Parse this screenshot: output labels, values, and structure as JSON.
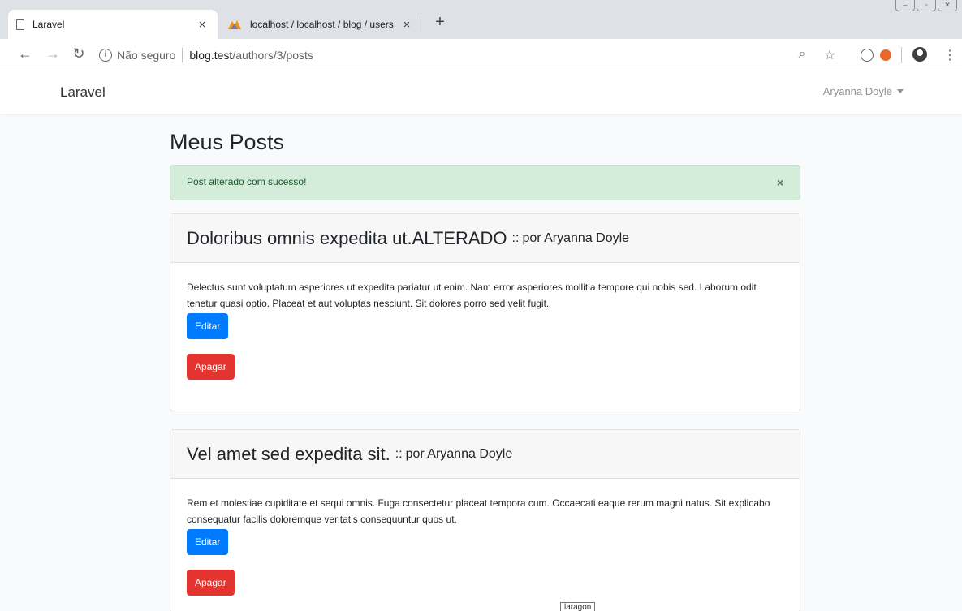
{
  "browser": {
    "tabs": [
      {
        "title": "Laravel",
        "close": "×"
      },
      {
        "title": "localhost / localhost / blog / users",
        "close": "×"
      }
    ],
    "new_tab": "+",
    "address": {
      "security": "Não seguro",
      "host": "blog.test",
      "path": "/authors/3/posts"
    }
  },
  "navbar": {
    "brand": "Laravel",
    "user": "Aryanna Doyle"
  },
  "page": {
    "title": "Meus Posts"
  },
  "alert": {
    "message": "Post alterado com sucesso!",
    "close": "×"
  },
  "posts": [
    {
      "title": "Doloribus omnis expedita ut.ALTERADO",
      "separator": "::",
      "author": "por Aryanna Doyle",
      "body": "Delectus sunt voluptatum asperiores ut expedita pariatur ut enim. Nam error asperiores mollitia tempore qui nobis sed. Laborum odit tenetur quasi optio. Placeat et aut voluptas nesciunt. Sit dolores porro sed velit fugit.",
      "edit_label": "Editar",
      "delete_label": "Apagar"
    },
    {
      "title": "Vel amet sed expedita sit.",
      "separator": "::",
      "author": "por Aryanna Doyle",
      "body": "Rem et molestiae cupiditate et sequi omnis. Fuga consectetur placeat tempora cum. Occaecati eaque rerum magni natus. Sit explicabo consequatur facilis doloremque veritatis consequuntur quos ut.",
      "edit_label": "Editar",
      "delete_label": "Apagar"
    }
  ],
  "tooltip": "laragon"
}
